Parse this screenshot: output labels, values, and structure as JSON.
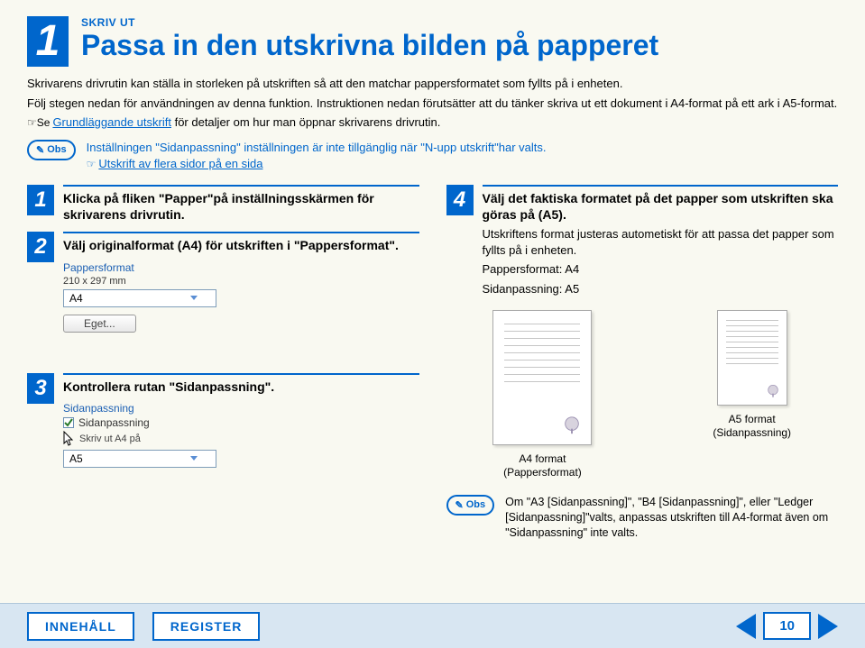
{
  "header": {
    "number": "1",
    "kicker": "SKRIV UT",
    "title": "Passa in den utskrivna bilden på papperet"
  },
  "intro": {
    "p1": "Skrivarens drivrutin kan ställa in storleken på utskriften så att den matchar pappersformatet som fyllts på i enheten.",
    "p2": "Följ stegen nedan för användningen av denna funktion. Instruktionen nedan förutsätter att du tänker skriva ut ett dokument i A4-format på ett ark i A5-format.",
    "link1_prefix": "☞Se ",
    "link1": "Grundläggande utskrift",
    "link1_suffix": " för detaljer om hur man öppnar skrivarens drivrutin."
  },
  "obs1": {
    "badge_icon": "✎",
    "badge": "Obs",
    "text": "Inställningen \"Sidanpassning\" inställningen är inte tillgänglig när \"N-upp utskrift\"har valts.",
    "link_prefix": "☞",
    "link": "Utskrift av flera sidor på en sida"
  },
  "steps": {
    "s1": {
      "num": "1",
      "title": "Klicka på fliken \"Papper\"på inställningsskärmen för skrivarens drivrutin."
    },
    "s2": {
      "num": "2",
      "title": "Välj originalformat (A4) för utskriften i \"Pappersformat\"."
    },
    "s3": {
      "num": "3",
      "title": "Kontrollera rutan \"Sidanpassning\"."
    },
    "s4": {
      "num": "4",
      "title": "Välj det faktiska formatet på det papper som utskriften ska göras på (A5).",
      "sub": "Utskriftens format justeras autometiskt för att passa det papper som fyllts på i enheten.",
      "note1": "Pappersformat: A4",
      "note2": "Sidanpassning: A5"
    }
  },
  "ui_mock1": {
    "group_label": "Pappersformat",
    "dims": "210 x 297 mm",
    "select": "A4",
    "button": "Eget..."
  },
  "ui_mock2": {
    "group_label": "Sidanpassning",
    "checkbox": "Sidanpassning",
    "text": "Skriv ut A4 på",
    "select": "A5"
  },
  "diagram": {
    "a4_line1": "A4 format",
    "a4_line2": "(Pappersformat)",
    "a5_line1": "A5 format",
    "a5_line2": "(Sidanpassning)"
  },
  "obs2": {
    "badge_icon": "✎",
    "badge": "Obs",
    "text": "Om \"A3 [Sidanpassning]\", \"B4 [Sidanpassning]\", eller \"Ledger [Sidanpassning]\"valts, anpassas utskriften till A4-format även om \"Sidanpassning\" inte valts."
  },
  "footer": {
    "btn1": "INNEHÅLL",
    "btn2": "REGISTER",
    "page": "10"
  }
}
